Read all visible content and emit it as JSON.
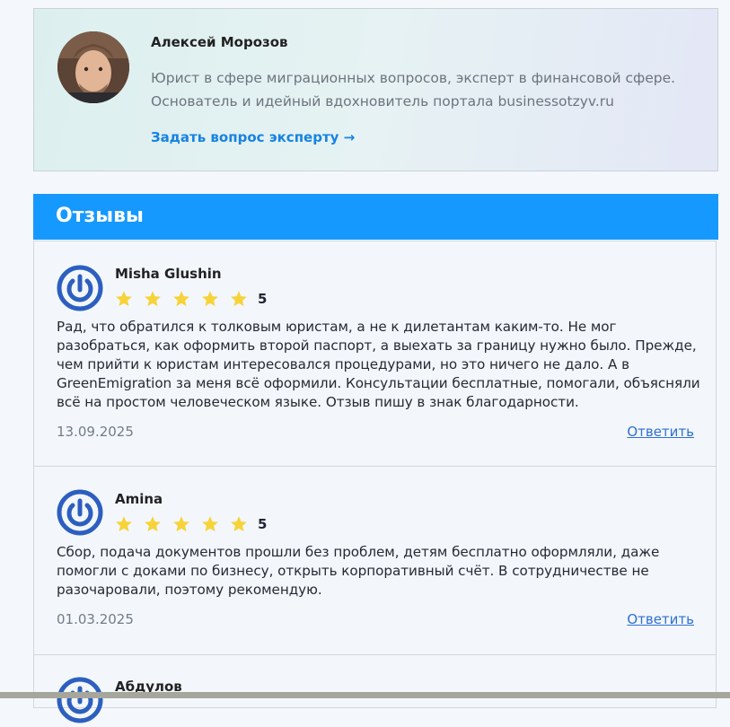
{
  "author": {
    "name": "Алексей Морозов",
    "bio": "Юрист в сфере миграционных вопросов, эксперт в финансовой сфере. Основатель и идейный вдохновитель портала businessotzyv.ru",
    "ask_link": "Задать вопрос эксперту →"
  },
  "reviews_section": {
    "title": "Отзывы"
  },
  "reviews": [
    {
      "name": "Misha Glushin",
      "rating": "5",
      "text": "Рад, что обратился к толковым юристам, а не к дилетантам каким-то. Не мог разобраться, как оформить второй паспорт, а выехать за границу нужно было. Прежде, чем прийти к юристам интересовался процедурами, но это ничего не дало. А в GreenEmigration за меня всё оформили. Консультации бесплатные, помогали, объясняли всё на простом человеческом языке. Отзыв пишу в знак благодарности.",
      "date": "13.09.2025",
      "reply": "Ответить"
    },
    {
      "name": "Amina",
      "rating": "5",
      "text": "Сбор, подача документов прошли без проблем, детям бесплатно оформляли, даже помогли с доками по бизнесу, открыть корпоративный счёт. В сотрудничестве не разочаровали, поэтому рекомендую.",
      "date": "01.03.2025",
      "reply": "Ответить"
    },
    {
      "name": "Абдулов"
    }
  ],
  "colors": {
    "accent": "#1699ff",
    "link": "#1683e3",
    "star": "#f7d33a",
    "avatar_ring": "#2c5fbf"
  },
  "icons": {
    "review_avatar": "power-icon",
    "rating": "star-icon",
    "ask_arrow": "arrow-right-icon"
  }
}
